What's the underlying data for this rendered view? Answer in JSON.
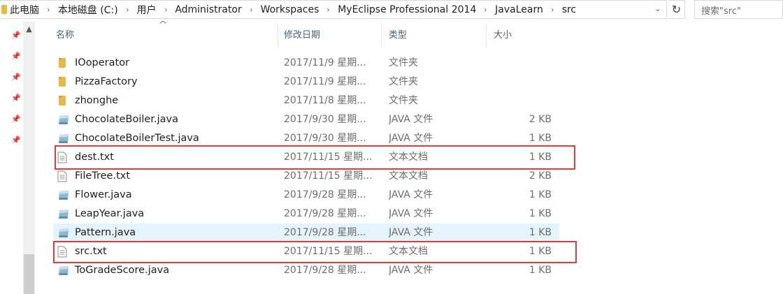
{
  "addressbar": {
    "breadcrumbs": [
      "此电脑",
      "本地磁盘 (C:)",
      "用户",
      "Administrator",
      "Workspaces",
      "MyEclipse Professional 2014",
      "JavaLearn",
      "src"
    ],
    "separator": "›",
    "dropdown": "⌄",
    "refresh": "↻"
  },
  "search": {
    "placeholder": "搜索\"src\""
  },
  "columns": {
    "name": "名称",
    "date": "修改日期",
    "type": "类型",
    "size": "大小"
  },
  "sort_caret": "^",
  "files": [
    {
      "name": "IOoperator",
      "date": "2017/11/9 星期...",
      "type": "文件夹",
      "size": "",
      "icon": "folder-icon"
    },
    {
      "name": "PizzaFactory",
      "date": "2017/11/9 星期...",
      "type": "文件夹",
      "size": "",
      "icon": "folder-icon"
    },
    {
      "name": "zhonghe",
      "date": "2017/11/8 星期...",
      "type": "文件夹",
      "size": "",
      "icon": "folder-icon"
    },
    {
      "name": "ChocolateBoiler.java",
      "date": "2017/9/30 星期...",
      "type": "JAVA 文件",
      "size": "2 KB",
      "icon": "java-file-icon"
    },
    {
      "name": "ChocolateBoilerTest.java",
      "date": "2017/9/30 星期...",
      "type": "JAVA 文件",
      "size": "1 KB",
      "icon": "java-file-icon"
    },
    {
      "name": "dest.txt",
      "date": "2017/11/15 星期...",
      "type": "文本文档",
      "size": "1 KB",
      "icon": "text-file-icon"
    },
    {
      "name": "FileTree.txt",
      "date": "2017/11/15 星期...",
      "type": "文本文档",
      "size": "2 KB",
      "icon": "text-file-icon"
    },
    {
      "name": "Flower.java",
      "date": "2017/9/28 星期...",
      "type": "JAVA 文件",
      "size": "1 KB",
      "icon": "java-file-icon"
    },
    {
      "name": "LeapYear.java",
      "date": "2017/9/28 星期...",
      "type": "JAVA 文件",
      "size": "1 KB",
      "icon": "java-file-icon"
    },
    {
      "name": "Pattern.java",
      "date": "2017/9/28 星期...",
      "type": "JAVA 文件",
      "size": "1 KB",
      "icon": "java-file-icon"
    },
    {
      "name": "src.txt",
      "date": "2017/11/15 星期...",
      "type": "文本文档",
      "size": "1 KB",
      "icon": "text-file-icon"
    },
    {
      "name": "ToGradeScore.java",
      "date": "2017/9/28 星期...",
      "type": "JAVA 文件",
      "size": "1 KB",
      "icon": "java-file-icon"
    }
  ],
  "hovered_file": "Pattern.java",
  "highlighted_files": [
    "dest.txt",
    "src.txt"
  ],
  "colors": {
    "highlight": "#e03c3c",
    "hover": "#e5f3ff",
    "folder": "#e9b84a",
    "header_text": "#4c607a"
  }
}
